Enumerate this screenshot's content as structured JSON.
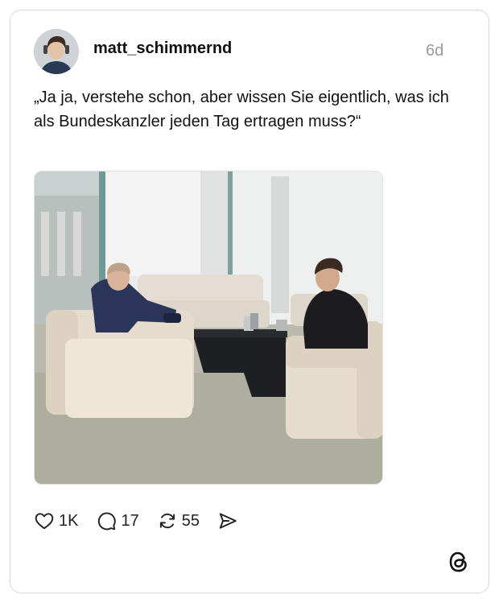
{
  "post": {
    "username": "matt_schimmernd",
    "time_ago": "6d",
    "text": "„Ja ja, verstehe schon, aber wissen Sie eigentlich, was ich als Bundeskanzler jeden Tag ertragen muss?“",
    "image_icon": "photo-two-men-in-armchairs"
  },
  "actions": {
    "like_icon": "heart-icon",
    "like_count": "1K",
    "reply_icon": "comment-bubble-icon",
    "reply_count": "17",
    "repost_icon": "repost-icon",
    "repost_count": "55",
    "share_icon": "send-icon"
  },
  "footer": {
    "logo_icon": "threads-logo-icon"
  },
  "colors": {
    "text": "#111111",
    "muted": "#9a9a9a",
    "border": "#d9d9d9"
  }
}
